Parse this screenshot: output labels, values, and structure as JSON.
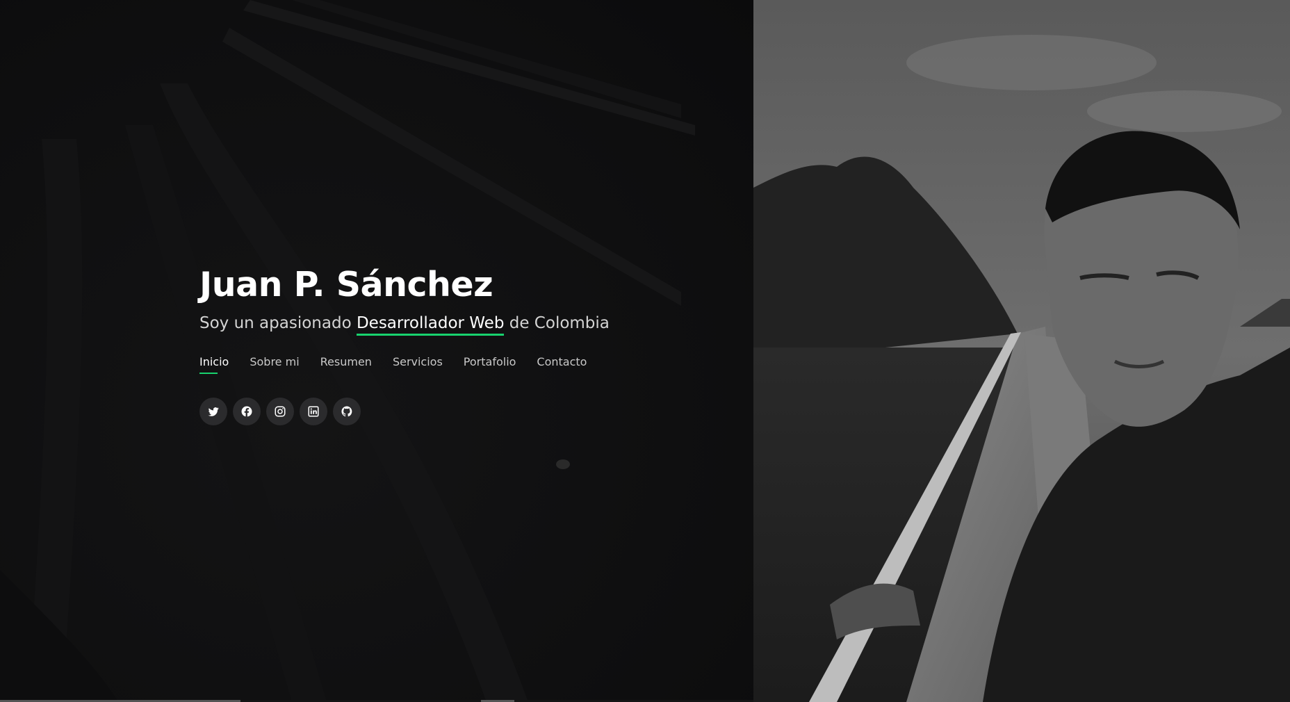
{
  "hero": {
    "title": "Juan P. Sánchez",
    "subtitle_prefix": "Soy un apasionado",
    "subtitle_highlight": "Desarrollador Web",
    "subtitle_suffix": "de Colombia"
  },
  "nav": {
    "items": [
      {
        "label": "Inicio",
        "active": true
      },
      {
        "label": "Sobre mi",
        "active": false
      },
      {
        "label": "Resumen",
        "active": false
      },
      {
        "label": "Servicios",
        "active": false
      },
      {
        "label": "Portafolio",
        "active": false
      },
      {
        "label": "Contacto",
        "active": false
      }
    ]
  },
  "social": {
    "icons": [
      "twitter-icon",
      "facebook-icon",
      "instagram-icon",
      "linkedin-icon",
      "github-icon"
    ]
  },
  "colors": {
    "accent": "#18d26e",
    "background": "#0f0f10",
    "icon_circle": "#2b2b2d"
  }
}
